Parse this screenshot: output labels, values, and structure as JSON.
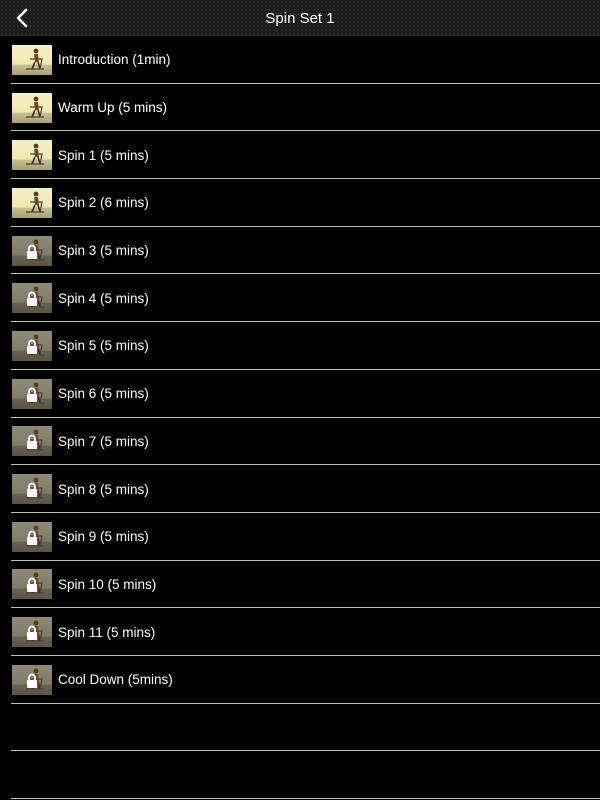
{
  "navbar": {
    "title": "Spin Set 1",
    "back_icon": "chevron-left-icon"
  },
  "items": [
    {
      "label": "Introduction (1min)",
      "locked": false
    },
    {
      "label": "Warm Up (5 mins)",
      "locked": false
    },
    {
      "label": "Spin 1 (5 mins)",
      "locked": false
    },
    {
      "label": "Spin 2 (6 mins)",
      "locked": false
    },
    {
      "label": "Spin 3 (5 mins)",
      "locked": true
    },
    {
      "label": "Spin 4 (5 mins)",
      "locked": true
    },
    {
      "label": "Spin 5 (5 mins)",
      "locked": true
    },
    {
      "label": "Spin 6 (5 mins)",
      "locked": true
    },
    {
      "label": "Spin 7 (5 mins)",
      "locked": true
    },
    {
      "label": "Spin 8 (5 mins)",
      "locked": true
    },
    {
      "label": "Spin 9 (5 mins)",
      "locked": true
    },
    {
      "label": "Spin 10 (5 mins)",
      "locked": true
    },
    {
      "label": "Spin 11 (5 mins)",
      "locked": true
    },
    {
      "label": "Cool Down (5mins)",
      "locked": true
    }
  ],
  "colors": {
    "background": "#000000",
    "navbar": "#1c1c1c",
    "separator": "#bfbfbf",
    "text": "#ffffff"
  }
}
